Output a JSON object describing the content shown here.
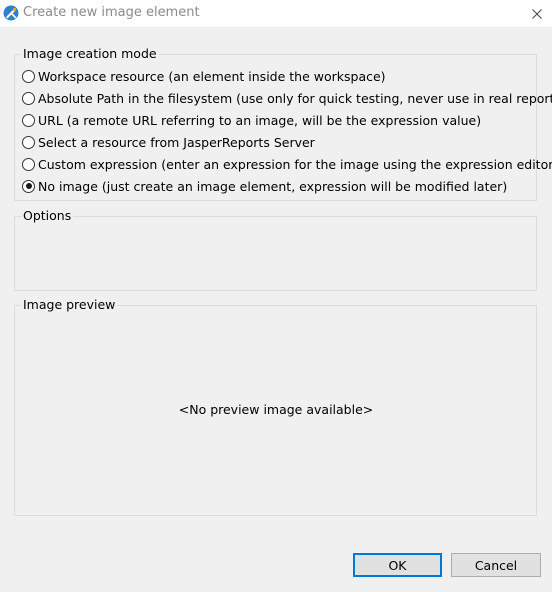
{
  "window": {
    "title": "Create new image element"
  },
  "mode_group": {
    "label": "Image creation mode",
    "options": [
      {
        "label": "Workspace resource (an element inside the workspace)",
        "checked": false
      },
      {
        "label": "Absolute Path in the filesystem (use only for quick testing, never use in real reports)",
        "checked": false
      },
      {
        "label": "URL (a remote URL referring to an image, will be the expression value)",
        "checked": false
      },
      {
        "label": "Select a resource from JasperReports Server",
        "checked": false
      },
      {
        "label": "Custom expression (enter an expression for the image using the expression editor)",
        "checked": false
      },
      {
        "label": "No image (just create an image element, expression will be modified later)",
        "checked": true
      }
    ]
  },
  "options_group": {
    "label": "Options"
  },
  "preview_group": {
    "label": "Image preview",
    "placeholder": "<No preview image available>"
  },
  "buttons": {
    "ok": "OK",
    "cancel": "Cancel"
  },
  "icons": {
    "app": "jaspersoft-studio-icon",
    "close": "close-icon"
  },
  "colors": {
    "default_button_border": "#0078d7",
    "title_text": "#8a8a8a"
  }
}
